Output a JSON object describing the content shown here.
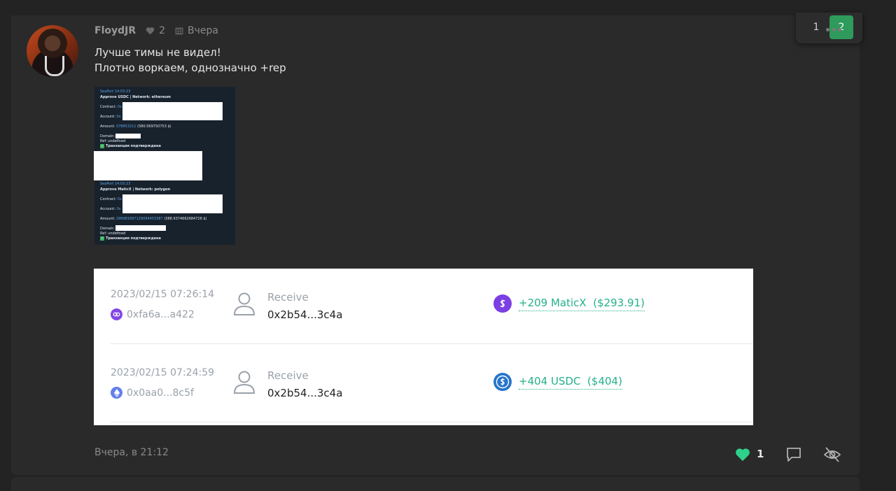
{
  "pagination": {
    "pages": [
      "1",
      "2"
    ],
    "current": "2"
  },
  "post": {
    "author": "FloydJR",
    "likes_count": "2",
    "date": "Вчера",
    "message_lines": [
      "Лучше тимы не видел!",
      "Плотно воркаем, однозначно +rep"
    ],
    "footer_time": "Вчера, в 21:12",
    "reaction_count": "1"
  },
  "screenshot_log": {
    "entry1": {
      "header": "SeaPort 14:03:23",
      "title": "Approve USDC | Network: ethereum",
      "contract_label": "Contract:",
      "contract_prefix": "0x",
      "account_label": "Account:",
      "account_prefix": "0x",
      "amount_label": "Amount:",
      "amount_value": "578853211",
      "amount_usd": "(580.569750753 $)",
      "domain_label": "Domain:",
      "ref_line": "Ref: undefined",
      "status": "Транзакция подтверждена"
    },
    "entry2": {
      "header": "SeaPort 14:03:23",
      "title": "Approve MaticX | Network: polygon",
      "contract_label": "Contract:",
      "contract_prefix": "0x",
      "account_label": "Account:",
      "account_prefix": "0x",
      "amount_label": "Amount:",
      "amount_value": "299981897129094453387",
      "amount_usd": "(388.9374662684728 $)",
      "domain_label": "Domain:",
      "ref_line": "Ref: undefined",
      "status": "Транзакция подтверждена"
    }
  },
  "transactions": [
    {
      "datetime": "2023/02/15 07:26:14",
      "tx_hash": "0xfa6a...a422",
      "chain_icon": "polygon-icon",
      "type": "Receive",
      "address": "0x2b54...3c4a",
      "token_icon": "maticx-icon",
      "amount": "+209 MaticX",
      "amount_usd": "($293.91)"
    },
    {
      "datetime": "2023/02/15 07:24:59",
      "tx_hash": "0x0aa0...8c5f",
      "chain_icon": "ethereum-icon",
      "type": "Receive",
      "address": "0x2b54...3c4a",
      "token_icon": "usdc-icon",
      "amount": "+404 USDC",
      "amount_usd": "($404)"
    }
  ],
  "colors": {
    "accent_green": "#2e9a5b",
    "tx_green": "#25b08a",
    "reaction_heart": "#2ed18a",
    "background": "#232323",
    "card": "#2a2a2a"
  }
}
